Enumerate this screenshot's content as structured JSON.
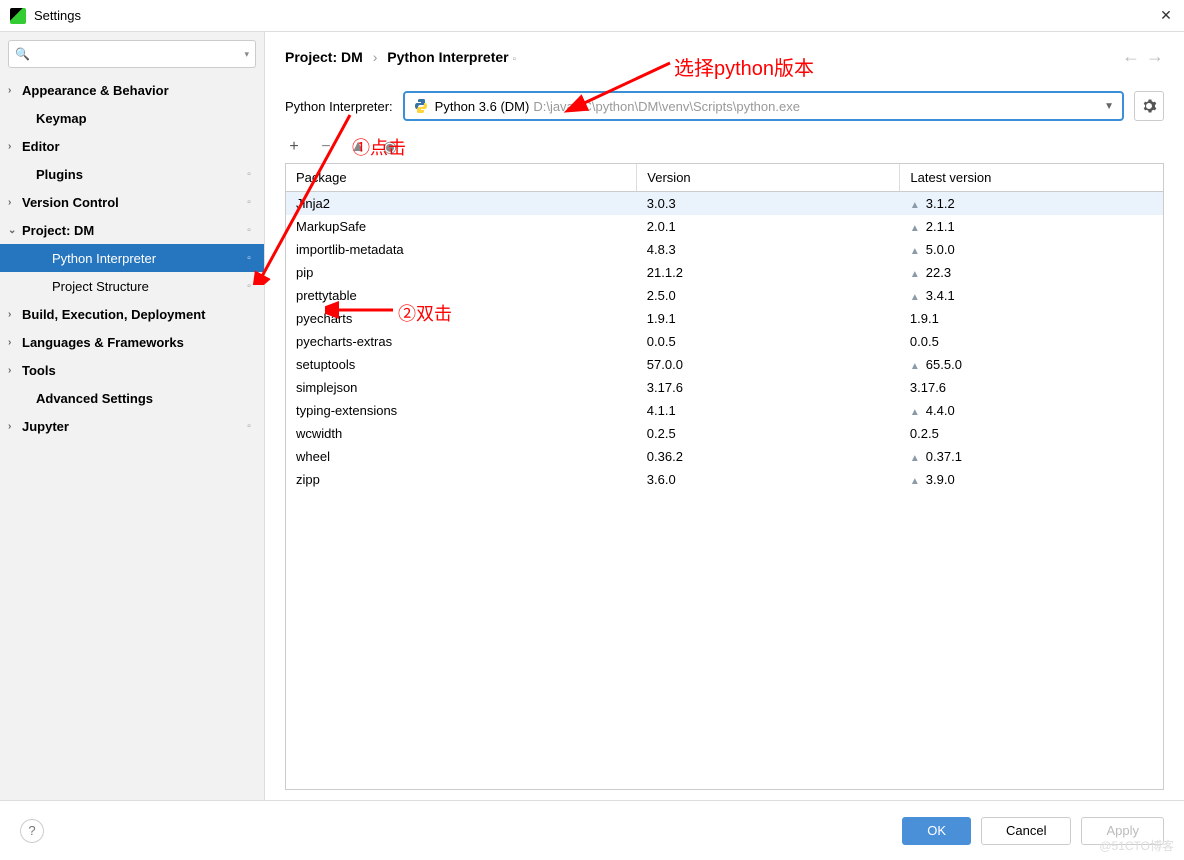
{
  "window": {
    "title": "Settings"
  },
  "search": {
    "placeholder": ""
  },
  "sidebar": {
    "items": [
      {
        "label": "Appearance & Behavior",
        "expandable": true,
        "bold": true,
        "level": 0
      },
      {
        "label": "Keymap",
        "expandable": false,
        "bold": true,
        "level": 1
      },
      {
        "label": "Editor",
        "expandable": true,
        "bold": true,
        "level": 0
      },
      {
        "label": "Plugins",
        "expandable": false,
        "bold": true,
        "level": 1,
        "reset": true
      },
      {
        "label": "Version Control",
        "expandable": true,
        "bold": true,
        "level": 0,
        "reset": true
      },
      {
        "label": "Project: DM",
        "expandable": true,
        "bold": true,
        "level": 0,
        "expanded": true,
        "reset": true
      },
      {
        "label": "Python Interpreter",
        "expandable": false,
        "bold": false,
        "level": 2,
        "selected": true,
        "reset": true
      },
      {
        "label": "Project Structure",
        "expandable": false,
        "bold": false,
        "level": 2,
        "reset": true
      },
      {
        "label": "Build, Execution, Deployment",
        "expandable": true,
        "bold": true,
        "level": 0
      },
      {
        "label": "Languages & Frameworks",
        "expandable": true,
        "bold": true,
        "level": 0
      },
      {
        "label": "Tools",
        "expandable": true,
        "bold": true,
        "level": 0
      },
      {
        "label": "Advanced Settings",
        "expandable": false,
        "bold": true,
        "level": 1
      },
      {
        "label": "Jupyter",
        "expandable": true,
        "bold": true,
        "level": 0,
        "reset": true
      }
    ]
  },
  "breadcrumb": {
    "project": "Project: DM",
    "page": "Python Interpreter"
  },
  "interpreter": {
    "label": "Python Interpreter:",
    "name": "Python 3.6 (DM)",
    "path": "D:\\javaBC\\python\\DM\\venv\\Scripts\\python.exe"
  },
  "table": {
    "headers": {
      "package": "Package",
      "version": "Version",
      "latest": "Latest version"
    },
    "rows": [
      {
        "pkg": "Jinja2",
        "ver": "3.0.3",
        "latest": "3.1.2",
        "update": true,
        "hover": true
      },
      {
        "pkg": "MarkupSafe",
        "ver": "2.0.1",
        "latest": "2.1.1",
        "update": true
      },
      {
        "pkg": "importlib-metadata",
        "ver": "4.8.3",
        "latest": "5.0.0",
        "update": true
      },
      {
        "pkg": "pip",
        "ver": "21.1.2",
        "latest": "22.3",
        "update": true
      },
      {
        "pkg": "prettytable",
        "ver": "2.5.0",
        "latest": "3.4.1",
        "update": true
      },
      {
        "pkg": "pyecharts",
        "ver": "1.9.1",
        "latest": "1.9.1",
        "update": false
      },
      {
        "pkg": "pyecharts-extras",
        "ver": "0.0.5",
        "latest": "0.0.5",
        "update": false
      },
      {
        "pkg": "setuptools",
        "ver": "57.0.0",
        "latest": "65.5.0",
        "update": true
      },
      {
        "pkg": "simplejson",
        "ver": "3.17.6",
        "latest": "3.17.6",
        "update": false
      },
      {
        "pkg": "typing-extensions",
        "ver": "4.1.1",
        "latest": "4.4.0",
        "update": true
      },
      {
        "pkg": "wcwidth",
        "ver": "0.2.5",
        "latest": "0.2.5",
        "update": false
      },
      {
        "pkg": "wheel",
        "ver": "0.36.2",
        "latest": "0.37.1",
        "update": true
      },
      {
        "pkg": "zipp",
        "ver": "3.6.0",
        "latest": "3.9.0",
        "update": true
      }
    ]
  },
  "footer": {
    "ok": "OK",
    "cancel": "Cancel",
    "apply": "Apply"
  },
  "annotations": {
    "select_python": "选择python版本",
    "click": "①点击",
    "double_click": "②双击"
  },
  "watermark": "@51CTO博客"
}
